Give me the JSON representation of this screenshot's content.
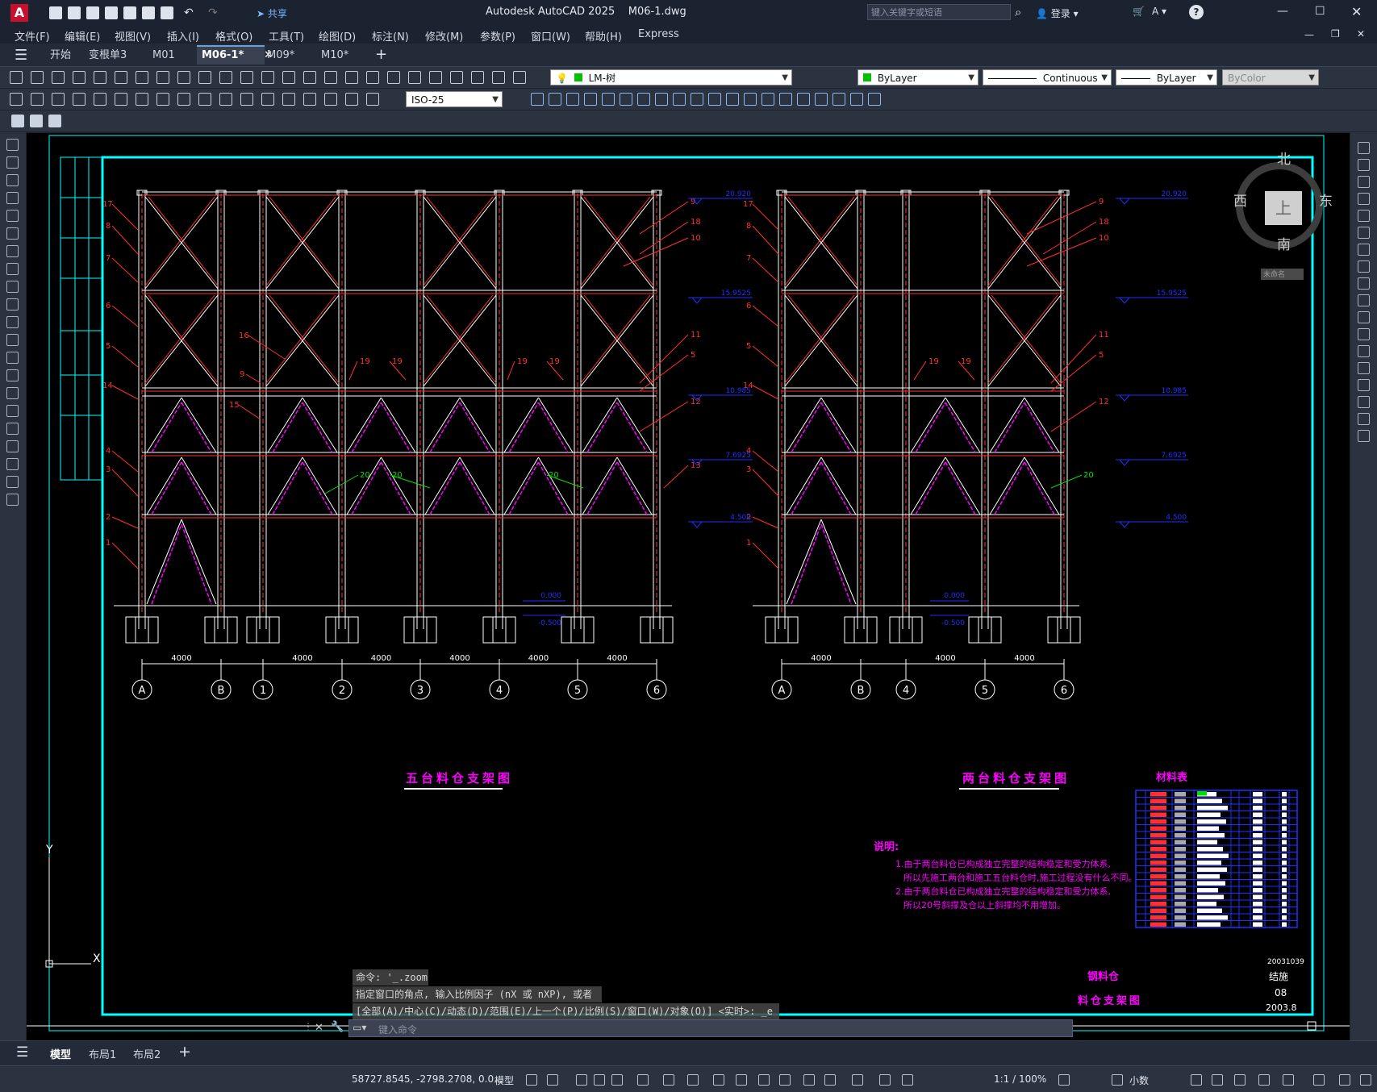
{
  "titlebar": {
    "app_title": "Autodesk AutoCAD 2025",
    "file_name": "M06-1.dwg",
    "search_placeholder": "键入关键字或短语",
    "login": "登录",
    "share": "共享"
  },
  "menu": [
    "文件(F)",
    "编辑(E)",
    "视图(V)",
    "插入(I)",
    "格式(O)",
    "工具(T)",
    "绘图(D)",
    "标注(N)",
    "修改(M)",
    "参数(P)",
    "窗口(W)",
    "帮助(H)",
    "Express"
  ],
  "tabs": [
    {
      "label": "开始",
      "active": false
    },
    {
      "label": "变根单3",
      "active": false
    },
    {
      "label": "M01",
      "active": false
    },
    {
      "label": "M06-1*",
      "active": true
    },
    {
      "label": "M09*",
      "active": false
    },
    {
      "label": "M10*",
      "active": false
    }
  ],
  "toolbar": {
    "layer": "LM-树",
    "color": "ByLayer",
    "linetype": "Continuous",
    "lineweight": "ByLayer",
    "plotstyle": "ByColor",
    "dimstyle": "ISO-25"
  },
  "viewcube": {
    "north": "北",
    "south": "南",
    "east": "东",
    "west": "西",
    "top": "上",
    "wcs": "未命名"
  },
  "drawing": {
    "left_title": "五台料仓支架图",
    "right_title": "两台料仓支架图",
    "material_table_title": "材料表",
    "notes_title": "说明:",
    "notes": [
      "1.由于两台料仓已构成独立完整的结构稳定和受力体系,",
      "所以先施工两台和施工五台料仓时,施工过程没有什么不同。",
      "2.由于两台料仓已构成独立完整的结构稳定和受力体系,",
      "所以20号斜撑及仓以上斜撑均不用增加。"
    ],
    "tb_project": "钢料仓",
    "tb_drawing": "料仓支架图",
    "tb_no": "20031039",
    "tb_type": "结施",
    "tb_sheet": "08",
    "tb_date": "2003.8",
    "elevations": [
      "20.920",
      "15.9525",
      "10.985",
      "7.6925",
      "4.500",
      "0.000",
      "-0.500"
    ],
    "left_axes": [
      "A",
      "B",
      "1",
      "2",
      "3",
      "4",
      "5",
      "6"
    ],
    "right_axes": [
      "A",
      "B",
      "4",
      "5",
      "6"
    ],
    "dim": "4000"
  },
  "command": {
    "line1": "命令: '_.zoom",
    "line2": "指定窗口的角点, 输入比例因子 (nX 或 nXP), 或者",
    "line3": "[全部(A)/中心(C)/动态(D)/范围(E)/上一个(P)/比例(S)/窗口(W)/对象(O)] <实时>: _e",
    "placeholder": "键入命令"
  },
  "layouts": [
    "模型",
    "布局1",
    "布局2"
  ],
  "status": {
    "coords": "58727.8545, -2798.2708, 0.0...",
    "model": "模型",
    "scale": "1:1 / 100%",
    "units": "小数"
  },
  "colors": {
    "frame": "#00ffff",
    "red": "#ff3030",
    "magenta": "#ff00ff",
    "blue": "#2030ff",
    "white": "#ffffff",
    "green": "#00e000"
  }
}
